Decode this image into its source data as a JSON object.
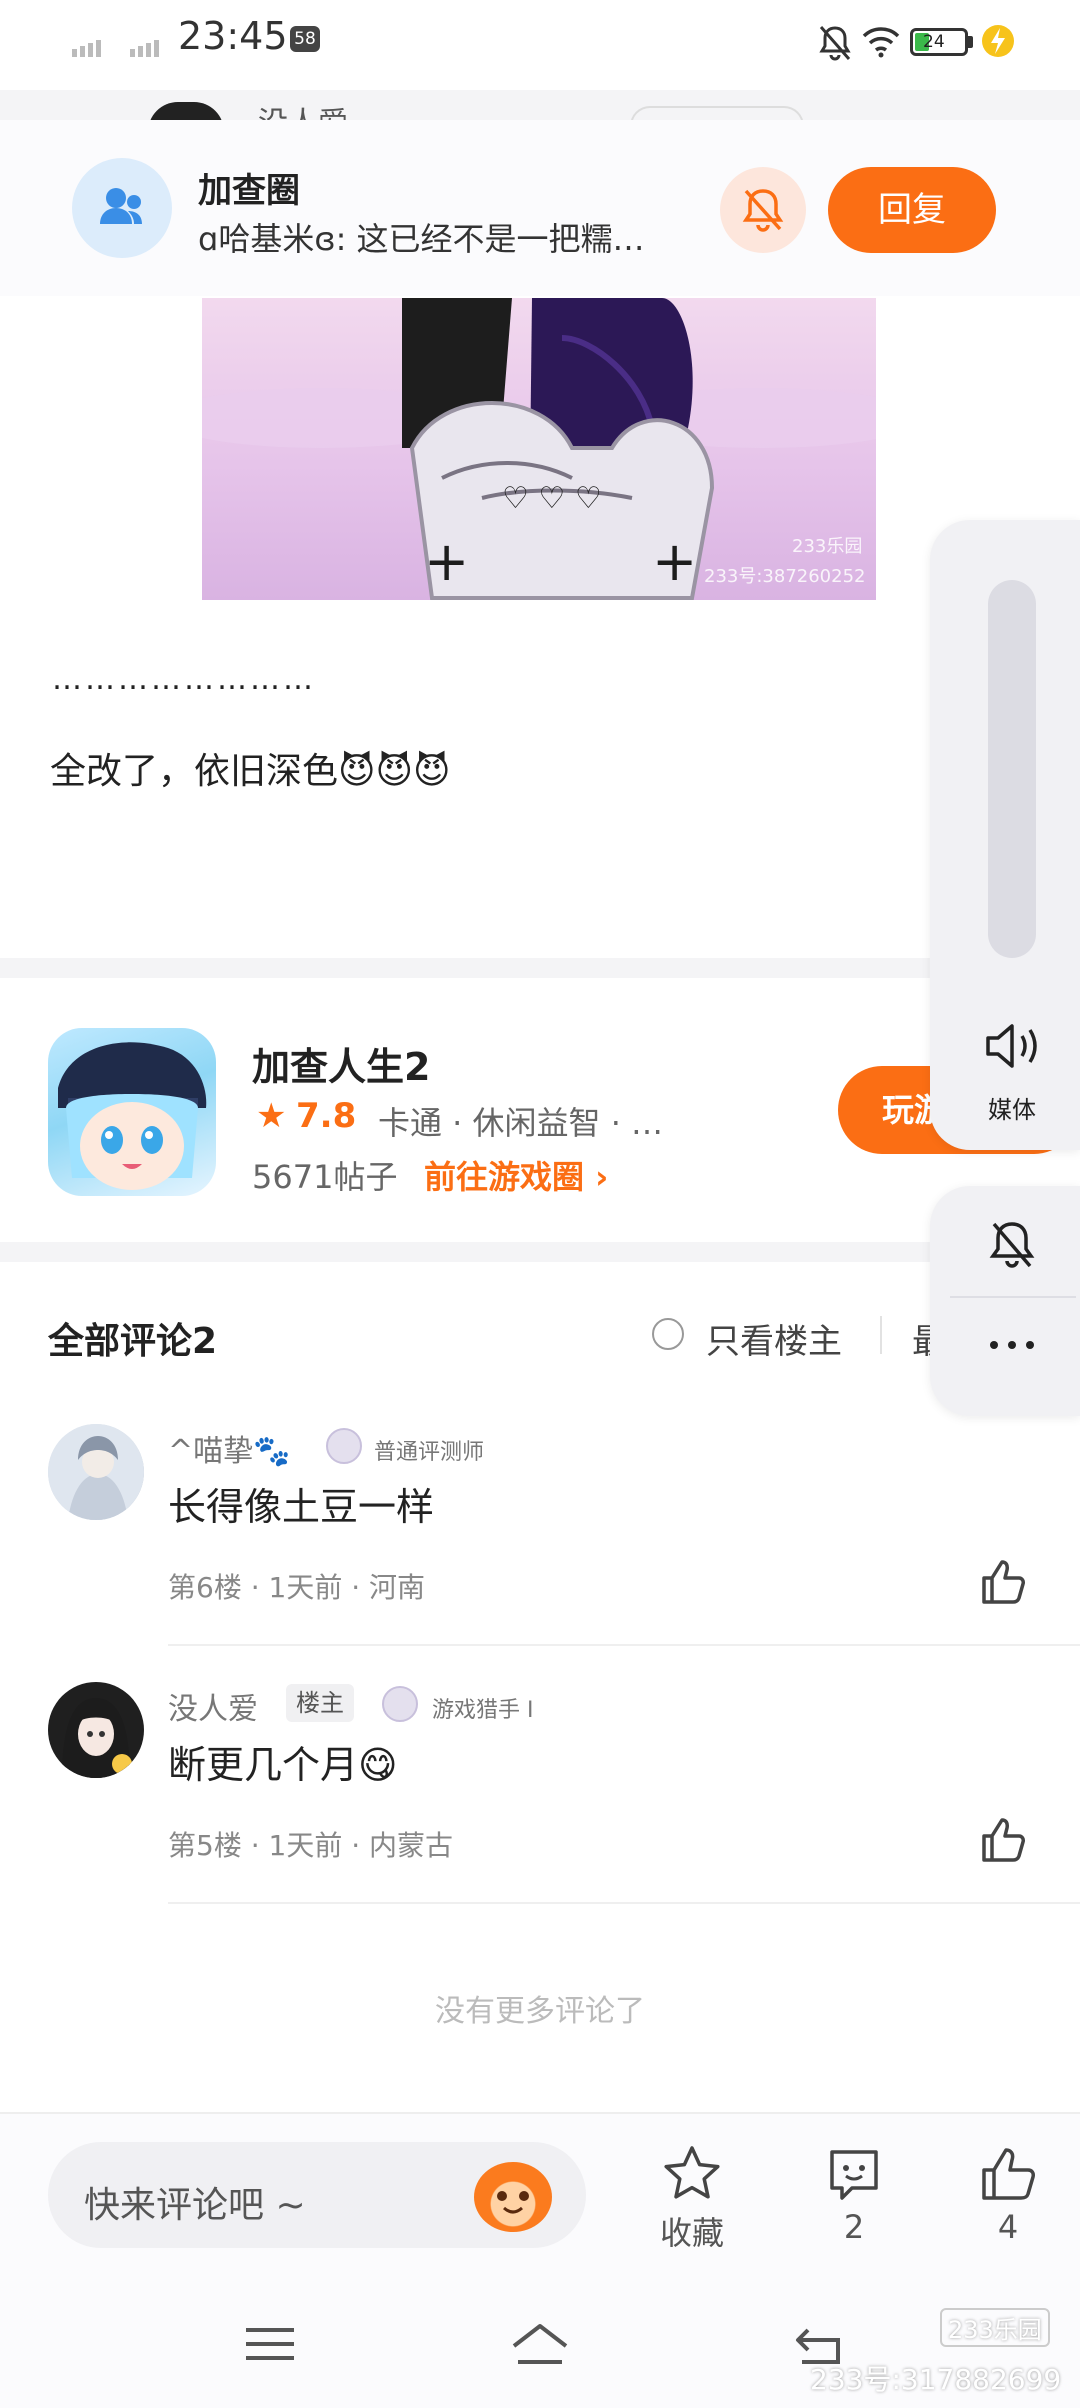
{
  "status_bar": {
    "time": "23:45",
    "badge": "58",
    "battery": "24"
  },
  "behind_header": {
    "name": "没人爱"
  },
  "header": {
    "group_title": "加查圈",
    "subtitle": "ɑ哈基米ɞ: 这已经不是一把糯…",
    "reply_label": "回复"
  },
  "post": {
    "image_watermark_brand": "233乐园",
    "image_watermark_id": "233号:387260252",
    "dots": "……………………",
    "text": "全改了，依旧深色😈😈😈"
  },
  "game_card": {
    "title": "加查人生2",
    "rating": "7.8",
    "tags": "卡通 · 休闲益智 · …",
    "posts_count": "5671帖子",
    "goto_label": "前往游戏圈 ›",
    "play_label": "玩游"
  },
  "comments": {
    "title": "全部评论2",
    "owner_only_label": "只看楼主",
    "sort_label": "最",
    "items": [
      {
        "username": "^喵挚🐾",
        "badge": "普通评测师",
        "text": "长得像土豆一样",
        "meta": "第6楼 · 1天前 · 河南"
      },
      {
        "username": "没人爱",
        "owner_tag": "楼主",
        "badge": "游戏猎手 I",
        "text": "断更几个月😋",
        "meta": "第5楼 · 1天前 · 内蒙古"
      }
    ],
    "no_more": "没有更多评论了"
  },
  "bottom_bar": {
    "input_placeholder": "快来评论吧 ~",
    "favorite_label": "收藏",
    "comment_count": "2",
    "like_count": "4"
  },
  "side_panel": {
    "media_label": "媒体"
  },
  "watermark": {
    "brand": "233乐园",
    "id": "233号:317882699"
  },
  "colors": {
    "accent": "#fb6e14",
    "blue": "#3a8ee6"
  }
}
